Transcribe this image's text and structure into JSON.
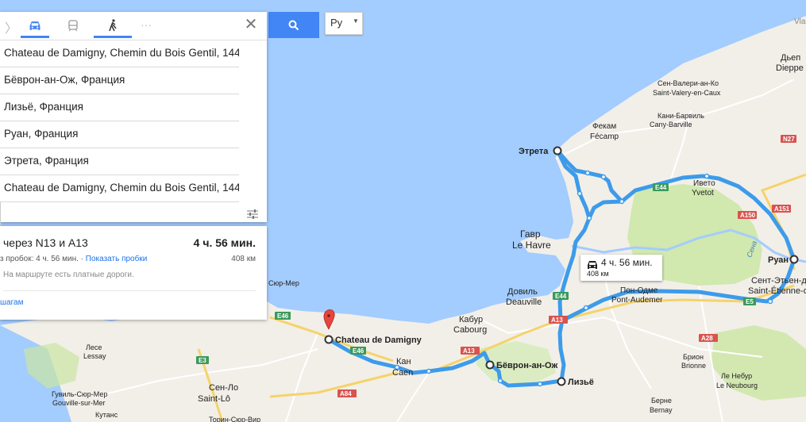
{
  "search": {
    "button_icon": "search-icon",
    "language": "Ру"
  },
  "modes": [
    {
      "name": "car",
      "active": true
    },
    {
      "name": "transit",
      "active": false
    },
    {
      "name": "walk",
      "active": false
    },
    {
      "name": "more",
      "active": false
    }
  ],
  "waypoints": [
    "Chateau de Damigny, Chemin du Bois Gentil, 144",
    "Бёврон-ан-Ож, Франция",
    "Лизьё, Франция",
    "Руан, Франция",
    "Этрета, Франция",
    "Chateau de Damigny, Chemin du Bois Gentil, 144"
  ],
  "route": {
    "via": "через N13 и A13",
    "duration": "4 ч. 56 мин.",
    "traffic_text": "з пробок: 4 ч. 56 мин. · ",
    "show_traffic": "Показать пробки",
    "distance": "408 км",
    "toll_note": "На маршруте есть платные дороги.",
    "steps_link": "шагам"
  },
  "tooltip": {
    "duration": "4 ч. 56 мин.",
    "distance": "408 км"
  },
  "map_labels": {
    "dieppe_ru": "Дьеп",
    "dieppe": "Dieppe",
    "svc_ru": "Сен-Валери-ан-Ко",
    "svc": "Saint-Valery-en-Caux",
    "cany_ru": "Кани-Барвиль",
    "cany": "Cany-Barville",
    "fecamp_ru": "Фекам",
    "fecamp": "Fécamp",
    "etretat": "Этрета",
    "yvetot_ru": "Ивето",
    "yvetot": "Yvetot",
    "havre_ru": "Гавр",
    "havre": "Le Havre",
    "rouen": "Руан",
    "seine": "Сена",
    "ser_ru": "Сент-Этьен-д",
    "ser": "Saint-Étienne-d",
    "pontaudemer_ru": "Пон-Одме",
    "pontaudemer": "Pont-Audemer",
    "deauville_ru": "Довиль",
    "deauville": "Deauville",
    "cabourg_ru": "Кабур",
    "cabourg": "Cabourg",
    "caen_ru": "Кан",
    "caen": "Caen",
    "beuvron": "Бёврон-ан-Ож",
    "lisieux": "Лизьё",
    "damigny": "Chateau de Damigny",
    "courseulles": "Сюр-Мер",
    "lessay_ru": "Лесе",
    "lessay": "Lessay",
    "gouville_ru": "Гувиль-Сюр-Мер",
    "gouville": "Gouville-sur-Mer",
    "stlo_ru": "Сен-Ло",
    "stlo": "Saint-Lô",
    "coutances": "Кутанс",
    "torigni": "Торин-Сюр-Вир",
    "brionne_ru": "Брион",
    "brionne": "Brionne",
    "neubourg_ru": "Ле Небур",
    "neubourg": "Le Neubourg",
    "bernay_ru": "Берне",
    "bernay": "Bernay",
    "vlad": "Vlad",
    "n27": "N27",
    "a151": "A151",
    "a150": "A150",
    "e44a": "E44",
    "e44b": "E44",
    "e5": "E5",
    "a13a": "A13",
    "a13b": "A13",
    "a28": "A28",
    "e46a": "E46",
    "e46b": "E46",
    "e3": "E3",
    "a84": "A84"
  },
  "colors": {
    "route": "#3d9bea",
    "water": "#a3ccff",
    "land": "#f2efe9",
    "forest": "#cbe6a3",
    "panel_accent": "#4285f4",
    "marker": "#e8453c"
  }
}
